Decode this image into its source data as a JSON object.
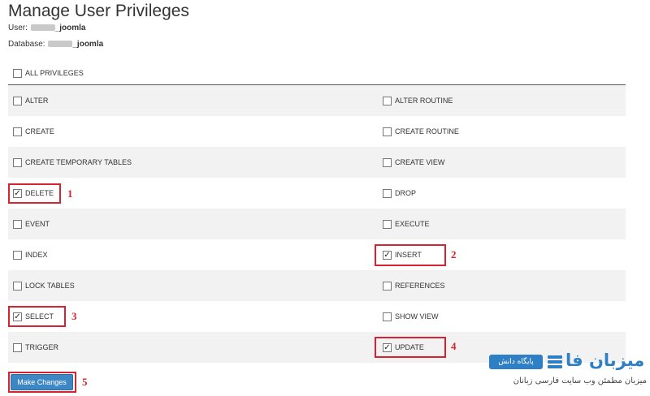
{
  "page": {
    "title": "Manage User Privileges",
    "user_label": "User:",
    "user_suffix": "_joomla",
    "database_label": "Database:",
    "database_suffix": "_joomla"
  },
  "all_privileges": {
    "label": "ALL PRIVILEGES",
    "checked": false
  },
  "privileges": [
    {
      "label": "ALTER",
      "checked": false
    },
    {
      "label": "ALTER ROUTINE",
      "checked": false
    },
    {
      "label": "CREATE",
      "checked": false
    },
    {
      "label": "CREATE ROUTINE",
      "checked": false
    },
    {
      "label": "CREATE TEMPORARY TABLES",
      "checked": false
    },
    {
      "label": "CREATE VIEW",
      "checked": false
    },
    {
      "label": "DELETE",
      "checked": true
    },
    {
      "label": "DROP",
      "checked": false
    },
    {
      "label": "EVENT",
      "checked": false
    },
    {
      "label": "EXECUTE",
      "checked": false
    },
    {
      "label": "INDEX",
      "checked": false
    },
    {
      "label": "INSERT",
      "checked": true
    },
    {
      "label": "LOCK TABLES",
      "checked": false
    },
    {
      "label": "REFERENCES",
      "checked": false
    },
    {
      "label": "SELECT",
      "checked": true
    },
    {
      "label": "SHOW VIEW",
      "checked": false
    },
    {
      "label": "TRIGGER",
      "checked": false
    },
    {
      "label": "UPDATE",
      "checked": true
    }
  ],
  "annotations": [
    "1",
    "2",
    "3",
    "4",
    "5"
  ],
  "actions": {
    "submit_label": "Make Changes"
  },
  "watermark": {
    "badge": "پایگاه دانش",
    "brand": "میزبان فا",
    "tagline": "میزبان مطمئن وب سایت فارسی زبانان"
  },
  "colors": {
    "highlight": "#d6232f",
    "button": "#3d87c4",
    "row_shade": "#f2f2f2",
    "brand": "#2f7fc4"
  }
}
